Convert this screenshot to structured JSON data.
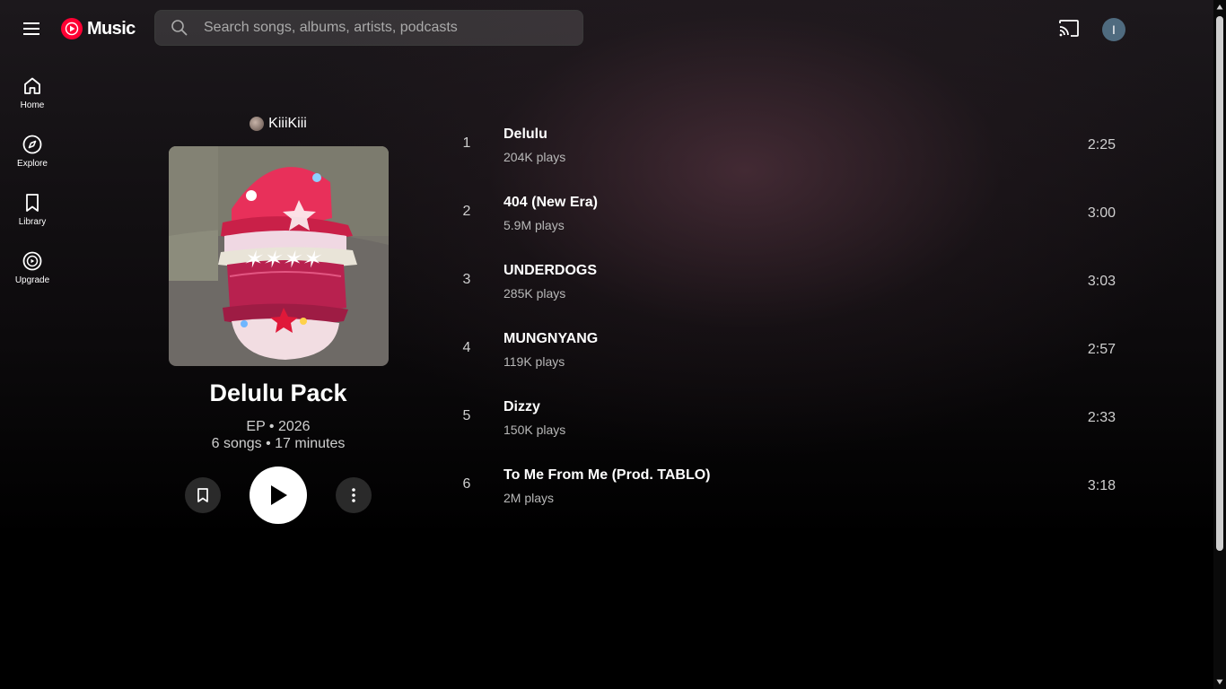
{
  "header": {
    "logo_text": "Music",
    "search_placeholder": "Search songs, albums, artists, podcasts",
    "avatar_letter": "I"
  },
  "sidebar": {
    "items": [
      {
        "label": "Home",
        "icon": "home-icon"
      },
      {
        "label": "Explore",
        "icon": "explore-icon"
      },
      {
        "label": "Library",
        "icon": "library-icon"
      },
      {
        "label": "Upgrade",
        "icon": "upgrade-icon"
      }
    ]
  },
  "album": {
    "artist": "KiiiKiii",
    "title": "Delulu Pack",
    "type_year": "EP • 2026",
    "songs_duration": "6 songs • 17 minutes"
  },
  "tracks": [
    {
      "num": "1",
      "title": "Delulu",
      "plays": "204K plays",
      "duration": "2:25"
    },
    {
      "num": "2",
      "title": "404 (New Era)",
      "plays": "5.9M plays",
      "duration": "3:00"
    },
    {
      "num": "3",
      "title": "UNDERDOGS",
      "plays": "285K plays",
      "duration": "3:03"
    },
    {
      "num": "4",
      "title": "MUNGNYANG",
      "plays": "119K plays",
      "duration": "2:57"
    },
    {
      "num": "5",
      "title": "Dizzy",
      "plays": "150K plays",
      "duration": "2:33"
    },
    {
      "num": "6",
      "title": "To Me From Me (Prod. TABLO)",
      "plays": "2M plays",
      "duration": "3:18"
    }
  ],
  "colors": {
    "brand_red": "#ff0033",
    "background": "#000000",
    "avatar": "#4f6b7f"
  }
}
